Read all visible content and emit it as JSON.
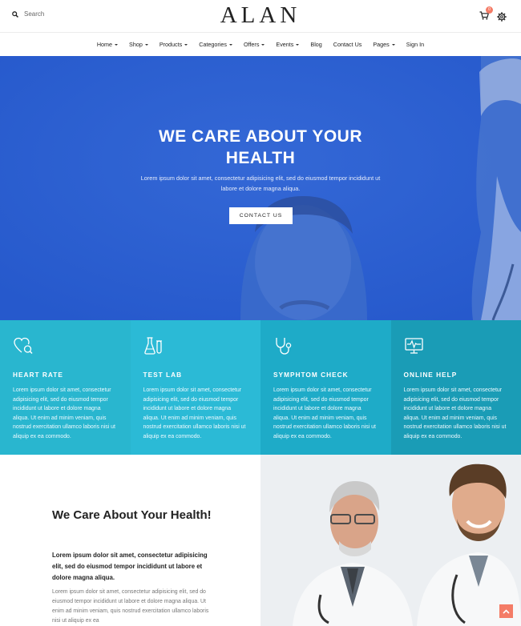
{
  "header": {
    "search_placeholder": "Search",
    "logo": "ALAN",
    "cart_count": "0"
  },
  "nav": {
    "items": [
      {
        "label": "Home",
        "dropdown": true
      },
      {
        "label": "Shop",
        "dropdown": true
      },
      {
        "label": "Products",
        "dropdown": true
      },
      {
        "label": "Categories",
        "dropdown": true
      },
      {
        "label": "Offers",
        "dropdown": true
      },
      {
        "label": "Events",
        "dropdown": true
      },
      {
        "label": "Blog",
        "dropdown": false
      },
      {
        "label": "Contact Us",
        "dropdown": false
      },
      {
        "label": "Pages",
        "dropdown": true
      },
      {
        "label": "Sign In",
        "dropdown": false
      }
    ]
  },
  "hero": {
    "title_line1": "WE CARE ABOUT YOUR",
    "title_line2": "HEALTH",
    "subtitle": "Lorem ipsum dolor sit amet, consectetur adipisicing elit, sed do eiusmod tempor incididunt ut labore et dolore magna aliqua.",
    "button": "CONTACT US",
    "bg_color": "#2a5fd0"
  },
  "features": [
    {
      "icon": "heart-search-icon",
      "title": "HEART RATE",
      "text": "Lorem ipsum dolor sit amet, consectetur adipisicing elit, sed do eiusmod tempor incididunt ut labore et dolore magna aliqua. Ut enim ad minim veniam, quis nostrud exercitation ullamco laboris nisi ut aliquip ex ea commodo.",
      "color": "#29b6cf"
    },
    {
      "icon": "flask-icon",
      "title": "TEST LAB",
      "text": "Lorem ipsum dolor sit amet, consectetur adipisicing elit, sed do eiusmod tempor incididunt ut labore et dolore magna aliqua. Ut enim ad minim veniam, quis nostrud exercitation ullamco laboris nisi ut aliquip ex ea commodo.",
      "color": "#2bbad6"
    },
    {
      "icon": "stethoscope-icon",
      "title": "SYMPHTOM CHECK",
      "text": "Lorem ipsum dolor sit amet, consectetur adipisicing elit, sed do eiusmod tempor incididunt ut labore et dolore magna aliqua. Ut enim ad minim veniam, quis nostrud exercitation ullamco laboris nisi ut aliquip ex ea commodo.",
      "color": "#1eabc8"
    },
    {
      "icon": "monitor-pulse-icon",
      "title": "ONLINE HELP",
      "text": "Lorem ipsum dolor sit amet, consectetur adipisicing elit, sed do eiusmod tempor incididunt ut labore et dolore magna aliqua. Ut enim ad minim veniam, quis nostrud exercitation ullamco laboris nisi ut aliquip ex ea commodo.",
      "color": "#1a9cb6"
    }
  ],
  "about": {
    "title": "We Care About Your Health!",
    "lead": "Lorem ipsum dolor sit amet, consectetur adipisicing elit, sed do eiusmod tempor incididunt ut labore et dolore magna aliqua.",
    "body": "Lorem ipsum dolor sit amet, consectetur adipisicing elit, sed do eiusmod tempor incididunt ut labore et dolore magna aliqua. Ut enim ad minim veniam, quis nostrud exercitation ullamco laboris nisi ut aliquip ex ea"
  },
  "accent_color": "#f47c67"
}
